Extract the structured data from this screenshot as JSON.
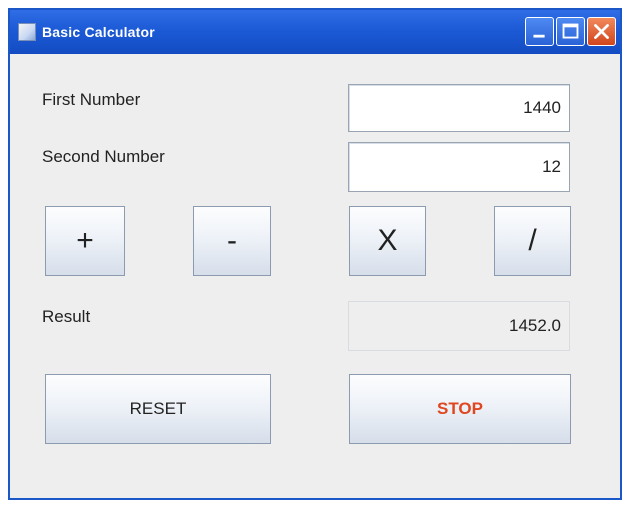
{
  "window": {
    "title": "Basic Calculator",
    "controls": {
      "minimize_icon": "minimize-icon",
      "maximize_icon": "maximize-icon",
      "close_icon": "close-icon"
    }
  },
  "form": {
    "first_label": "First Number",
    "first_value": "1440",
    "second_label": "Second Number",
    "second_value": "12",
    "result_label": "Result",
    "result_value": "1452.0"
  },
  "operations": {
    "add": "+",
    "subtract": "-",
    "multiply": "X",
    "divide": "/"
  },
  "actions": {
    "reset": "RESET",
    "stop": "STOP"
  },
  "colors": {
    "titlebar": "#1c5ad6",
    "stop_text": "#e0461f"
  }
}
